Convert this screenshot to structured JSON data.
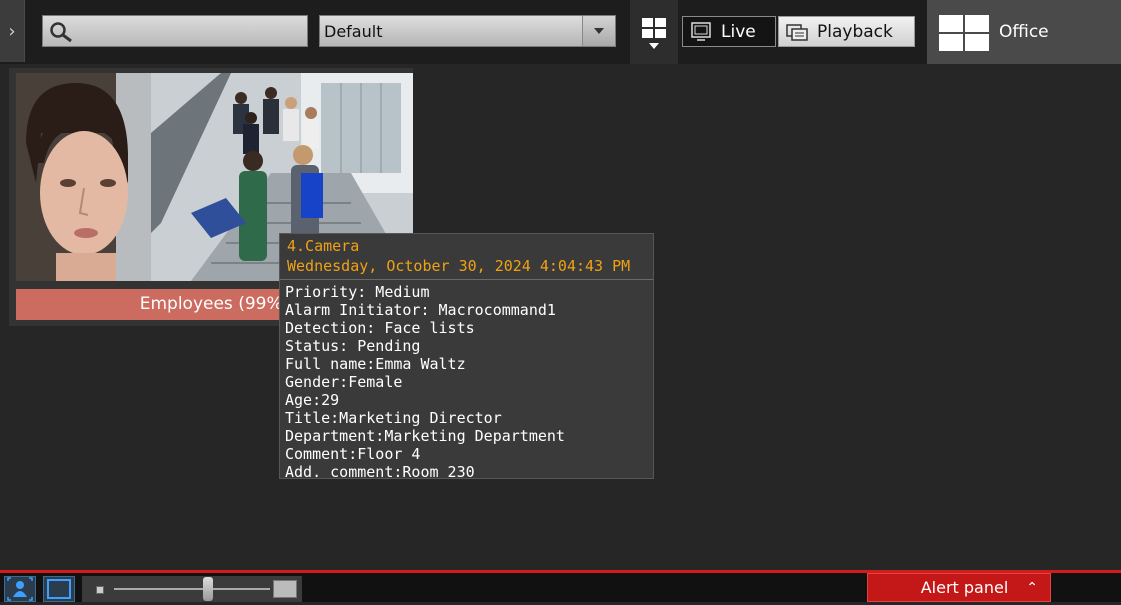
{
  "toolbar": {
    "expand_icon": "chevron-right-icon",
    "search": {
      "value": "",
      "icon": "search-icon"
    },
    "layout_select": {
      "value": "Default"
    },
    "live_label": "Live",
    "playback_label": "Playback",
    "layout_name": "Office"
  },
  "camera_tile": {
    "caption": "Employees (99%)"
  },
  "tooltip": {
    "camera": "4.Camera",
    "datetime": "Wednesday, October 30, 2024 4:04:43 PM",
    "lines": [
      "Priority: Medium",
      "Alarm Initiator: Macrocommand1",
      "Detection: Face lists",
      "Status: Pending",
      "Full name:Emma Waltz",
      "Gender:Female",
      "Age:29",
      "Title:Marketing Director",
      "Department:Marketing Department",
      "Comment:Floor 4",
      "Add. comment:Room 230"
    ]
  },
  "bottom_bar": {
    "zoom_level": 0.6,
    "alert_panel_label": "Alert panel"
  },
  "colors": {
    "alert_red": "#c41717",
    "tooltip_accent": "#f0a214",
    "caption_bg": "#cc6b60"
  }
}
